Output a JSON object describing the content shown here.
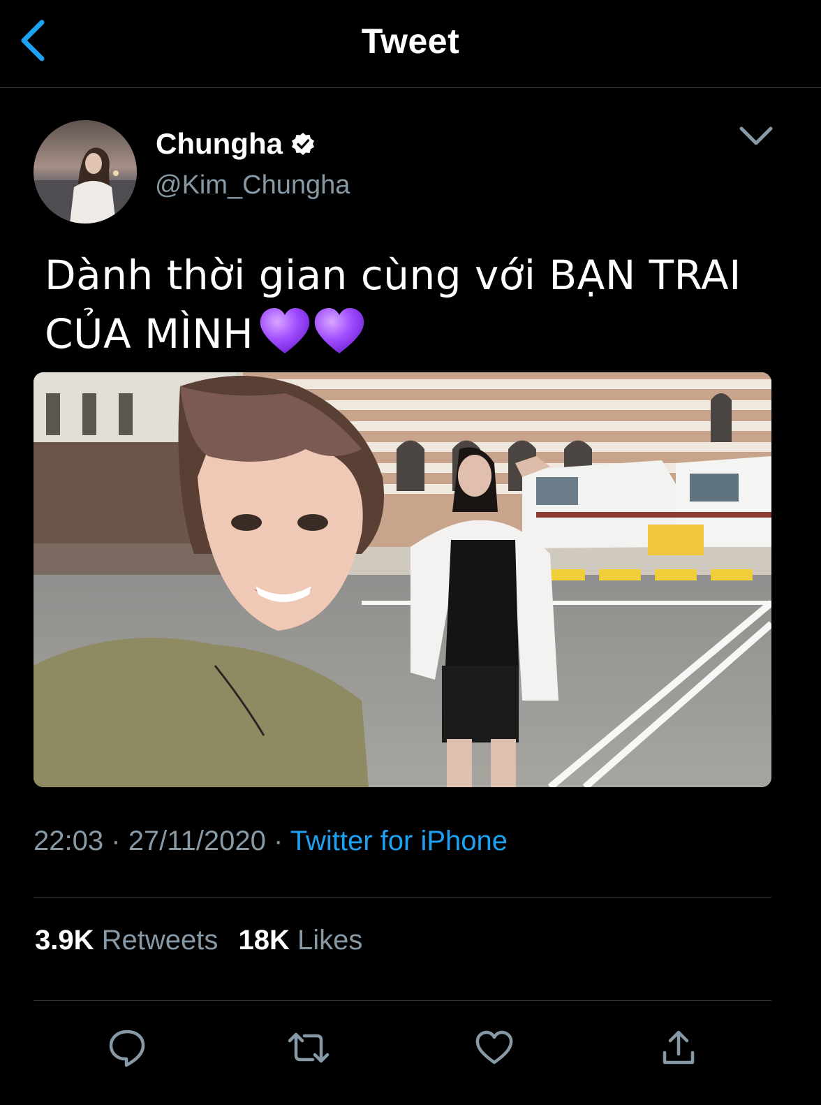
{
  "nav": {
    "title": "Tweet",
    "accent": "#1da1f2",
    "back_icon": "chevron-left-icon"
  },
  "author": {
    "display_name": "Chungha",
    "handle": "@Kim_Chungha",
    "verified": true
  },
  "tweet": {
    "text_line1": "Dành thời gian cùng với BẠN TRAI",
    "text_line2": "CỦA MÌNH",
    "emoji": "purple-heart-icon ×2",
    "media_description_icon": "photo"
  },
  "meta": {
    "time": "22:03",
    "separator": "·",
    "date": "27/11/2020",
    "source": "Twitter for iPhone"
  },
  "stats": {
    "retweets_count": "3.9K",
    "retweets_label": "Retweets",
    "likes_count": "18K",
    "likes_label": "Likes"
  },
  "actions": [
    "reply-icon",
    "retweet-icon",
    "like-icon",
    "share-icon"
  ],
  "colors": {
    "background": "#000000",
    "secondary_text": "#8899a6",
    "link": "#1da1f2",
    "divider": "#2f3336",
    "heart_emoji": "#9b4dff"
  }
}
